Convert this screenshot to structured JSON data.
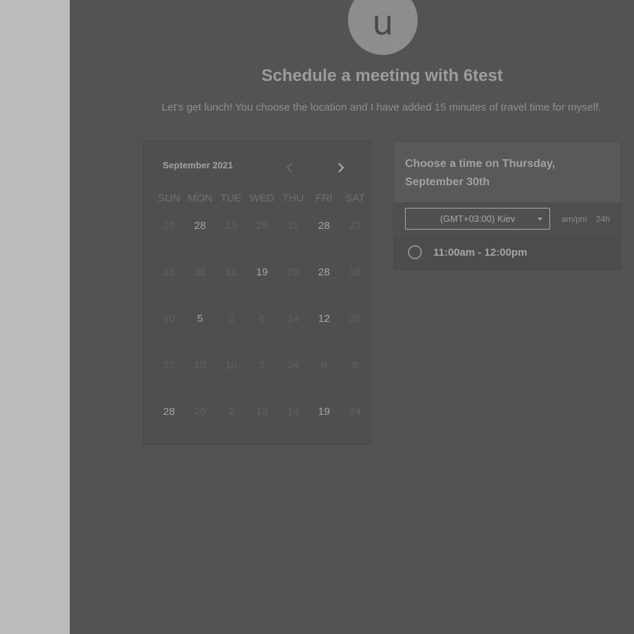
{
  "page": {
    "avatar_letter": "u",
    "title": "Schedule a meeting with 6test",
    "subtitle": "Let's get lunch! You choose the location and I have added 15 minutes of travel time for myself."
  },
  "calendar": {
    "month_label": "September 2021",
    "prev_icon": "chevron-left-icon",
    "next_icon": "chevron-right-icon",
    "weekdays": [
      "SUN",
      "MON",
      "TUE",
      "WED",
      "THU",
      "FRI",
      "SAT"
    ],
    "weeks": [
      [
        "23",
        "28",
        "13",
        "25",
        "21",
        "28",
        "23"
      ],
      [
        "16",
        "30",
        "11",
        "19",
        "29",
        "28",
        "18"
      ],
      [
        "20",
        "5",
        "3",
        "6",
        "14",
        "12",
        "20"
      ],
      [
        "27",
        "10",
        "10",
        "2",
        "24",
        "6",
        "8"
      ],
      [
        "28",
        "20",
        "2",
        "18",
        "14",
        "19",
        "24"
      ]
    ],
    "active_cells": [
      "0.1",
      "0.5",
      "1.3",
      "1.5",
      "2.1",
      "2.5",
      "4.0",
      "4.5"
    ]
  },
  "times": {
    "header": "Choose a time on Thursday, September 30th",
    "timezone": "(GMT+03:00) Kiev",
    "format_ampm": "am/pm",
    "format_24h": "24h",
    "slots": [
      "11:00am - 12:00pm"
    ]
  },
  "colors": {
    "overlay": "#535353",
    "gutter": "#bbbbbb"
  }
}
